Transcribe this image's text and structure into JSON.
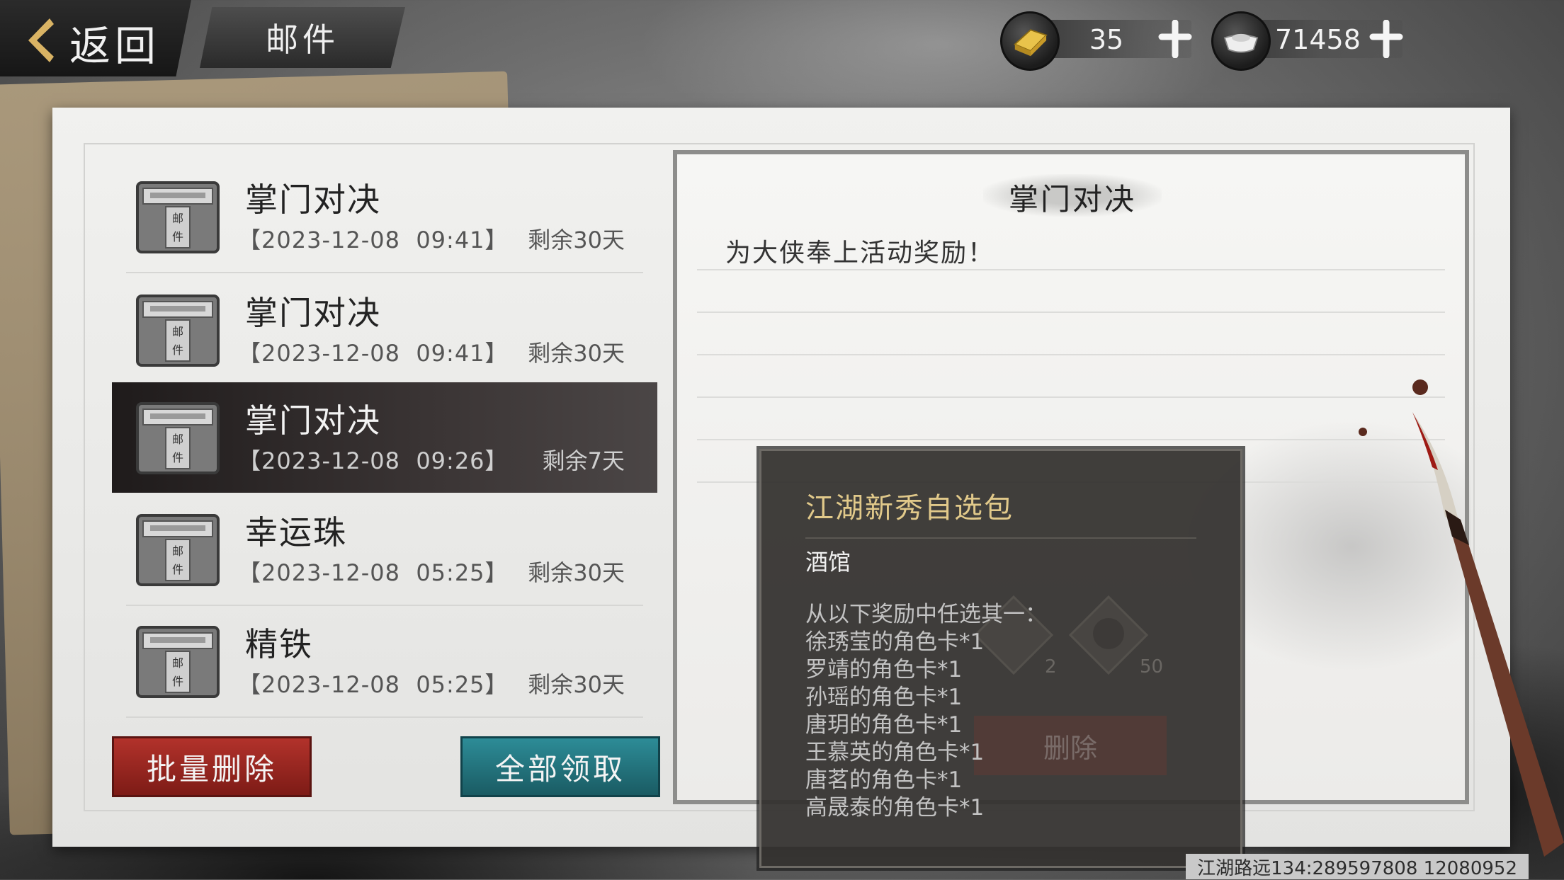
{
  "header": {
    "back_label": "返回",
    "title": "邮件",
    "currencies": [
      {
        "icon": "gold-ingot-icon",
        "value": "35"
      },
      {
        "icon": "silver-ingot-icon",
        "value": "71458"
      }
    ]
  },
  "mail_list": [
    {
      "title": "掌门对决",
      "date": "【2023-12-08  09:41】",
      "remaining": "剩余30天",
      "selected": false
    },
    {
      "title": "掌门对决",
      "date": "【2023-12-08  09:41】",
      "remaining": "剩余30天",
      "selected": false
    },
    {
      "title": "掌门对决",
      "date": "【2023-12-08  09:26】",
      "remaining": "剩余7天",
      "selected": true
    },
    {
      "title": "幸运珠",
      "date": "【2023-12-08  05:25】",
      "remaining": "剩余30天",
      "selected": false
    },
    {
      "title": "精铁",
      "date": "【2023-12-08  05:25】",
      "remaining": "剩余30天",
      "selected": false
    }
  ],
  "buttons": {
    "batch_delete": "批量删除",
    "claim_all": "全部领取"
  },
  "detail": {
    "title": "掌门对决",
    "message": "为大侠奉上活动奖励！",
    "delete_label": "删除",
    "item_counts": [
      "2",
      "50"
    ]
  },
  "tooltip": {
    "title": "江湖新秀自选包",
    "source": "酒馆",
    "lines": [
      "从以下奖励中任选其一：",
      "徐琇莹的角色卡*1",
      "罗靖的角色卡*1",
      "孙瑶的角色卡*1",
      "唐玥的角色卡*1",
      "王慕英的角色卡*1",
      "唐茗的角色卡*1",
      "高晟泰的角色卡*1"
    ]
  },
  "footer": {
    "text": "江湖路远134:289597808  12080952"
  },
  "colors": {
    "accent_gold": "#e1c98a",
    "delete_red": "#b2322b",
    "claim_teal": "#2d8c97"
  }
}
